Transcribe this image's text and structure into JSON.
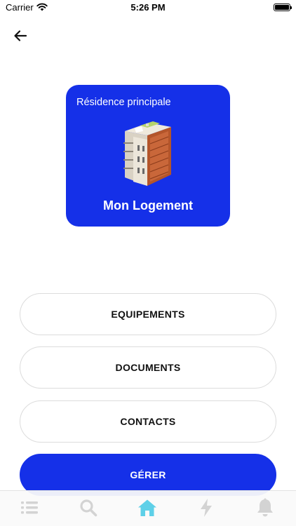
{
  "status_bar": {
    "carrier": "Carrier",
    "time": "5:26 PM"
  },
  "card": {
    "subtitle": "Résidence principale",
    "title": "Mon Logement",
    "image": "apartment-building-illustration"
  },
  "menu": {
    "equipements_label": "EQUIPEMENTS",
    "documents_label": "DOCUMENTS",
    "contacts_label": "CONTACTS",
    "gerer_label": "GÉRER"
  },
  "tab_bar": {
    "tabs": [
      {
        "icon": "list-icon",
        "active": false
      },
      {
        "icon": "search-icon",
        "active": false
      },
      {
        "icon": "home-icon",
        "active": true
      },
      {
        "icon": "lightning-icon",
        "active": false
      },
      {
        "icon": "bell-icon",
        "active": false
      }
    ]
  },
  "colors": {
    "primary": "#1530e8",
    "tab_active": "#5ed0e8",
    "tab_inactive": "#d3d3d3",
    "pill_border": "#dcdcdc"
  }
}
